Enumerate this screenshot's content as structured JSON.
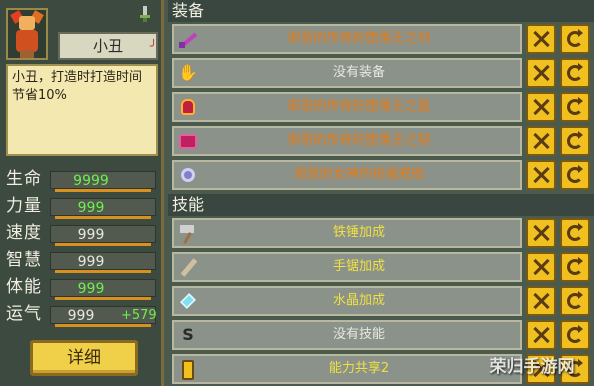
{
  "character": {
    "name": "小丑",
    "description": "小丑，打造时打造时间节省10%"
  },
  "stats": [
    {
      "label": "生命",
      "value": "9999",
      "green": true,
      "bonus": ""
    },
    {
      "label": "力量",
      "value": "999",
      "green": true,
      "bonus": ""
    },
    {
      "label": "速度",
      "value": "999",
      "green": false,
      "bonus": ""
    },
    {
      "label": "智慧",
      "value": "999",
      "green": false,
      "bonus": ""
    },
    {
      "label": "体能",
      "value": "999",
      "green": true,
      "bonus": ""
    },
    {
      "label": "运气",
      "value": "999",
      "green": false,
      "bonus": "+579"
    }
  ],
  "detail_button": "详细",
  "equipment": {
    "header": "装备",
    "items": [
      {
        "icon": "sword-icon",
        "label": "邪恶的传奇的堕落王之剑",
        "color": "orange"
      },
      {
        "icon": "glove-icon",
        "label": "没有装备",
        "color": "gray"
      },
      {
        "icon": "helmet-icon",
        "label": "邪恶的传奇的堕落王之盔",
        "color": "orange"
      },
      {
        "icon": "armor-icon",
        "label": "邪恶的传奇的堕落王之铠",
        "color": "orange"
      },
      {
        "icon": "ring-icon",
        "label": "邪恶的女神的祝福戒指",
        "color": "orange"
      }
    ]
  },
  "skills": {
    "header": "技能",
    "items": [
      {
        "icon": "hammer-icon",
        "label": "铁锤加成",
        "color": "yellow"
      },
      {
        "icon": "saw-icon",
        "label": "手锯加成",
        "color": "yellow"
      },
      {
        "icon": "crystal-icon",
        "label": "水晶加成",
        "color": "yellow"
      },
      {
        "icon": "skill-icon",
        "label": "没有技能",
        "color": "gray"
      },
      {
        "icon": "share-icon",
        "label": "能力共享2",
        "color": "yellow"
      }
    ]
  },
  "watermark": "荣归手游网"
}
